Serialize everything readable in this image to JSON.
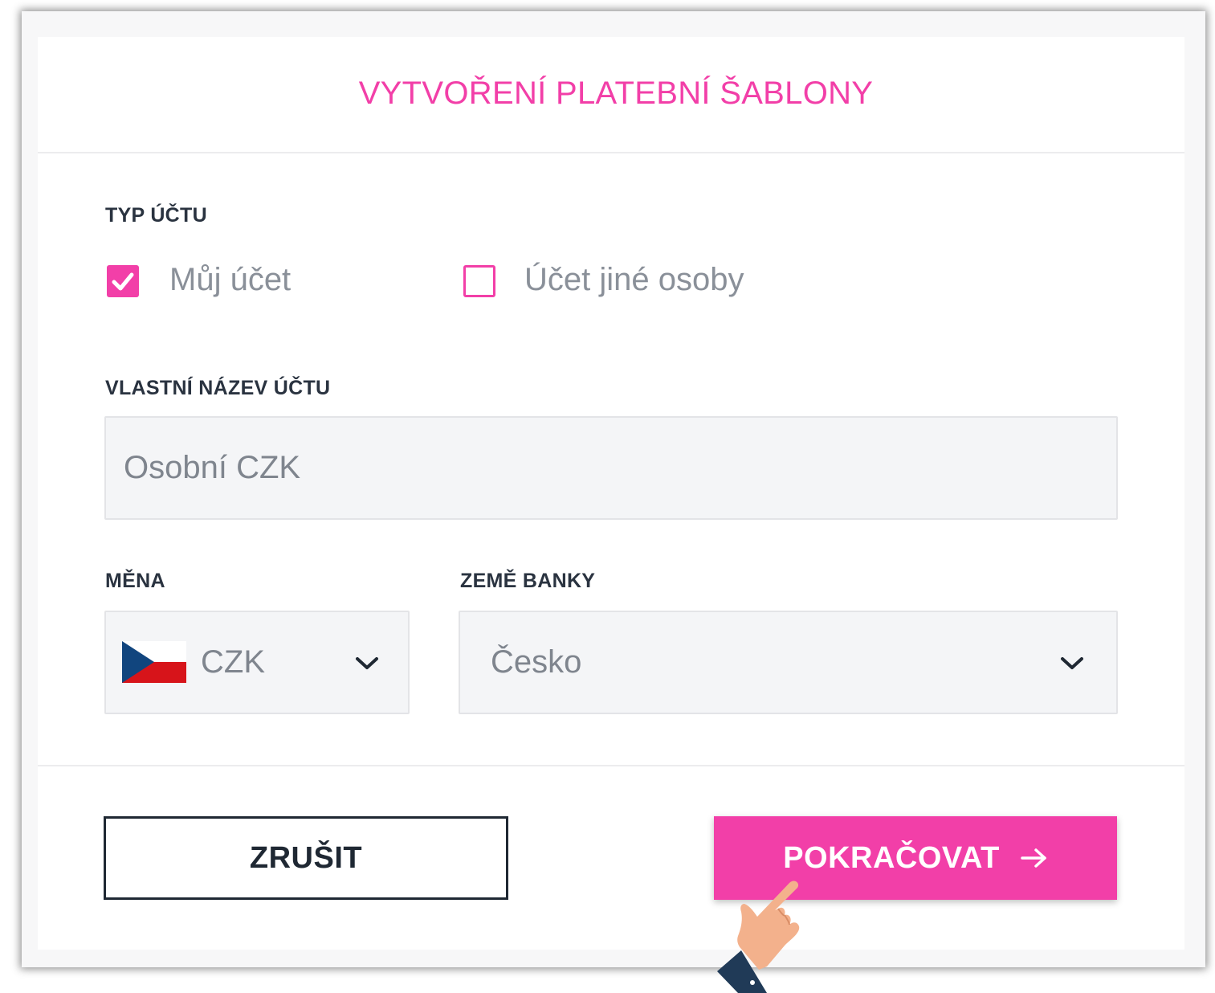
{
  "dialog": {
    "title": "VYTVOŘENÍ PLATEBNÍ ŠABLONY"
  },
  "account_type": {
    "label": "TYP ÚČTU",
    "options": [
      {
        "label": "Můj účet",
        "checked": true
      },
      {
        "label": "Účet jiné osoby",
        "checked": false
      }
    ]
  },
  "account_name": {
    "label": "VLASTNÍ NÁZEV ÚČTU",
    "value": "Osobní CZK"
  },
  "currency": {
    "label": "MĚNA",
    "value": "CZK",
    "flag_icon": "czech-flag-icon"
  },
  "bank_country": {
    "label": "ZEMĚ BANKY",
    "value": "Česko"
  },
  "buttons": {
    "cancel": "ZRUŠIT",
    "continue": "POKRAČOVAT"
  },
  "colors": {
    "accent": "#f23fa8",
    "text_dark": "#1f2833",
    "field_bg": "#f4f5f7"
  }
}
